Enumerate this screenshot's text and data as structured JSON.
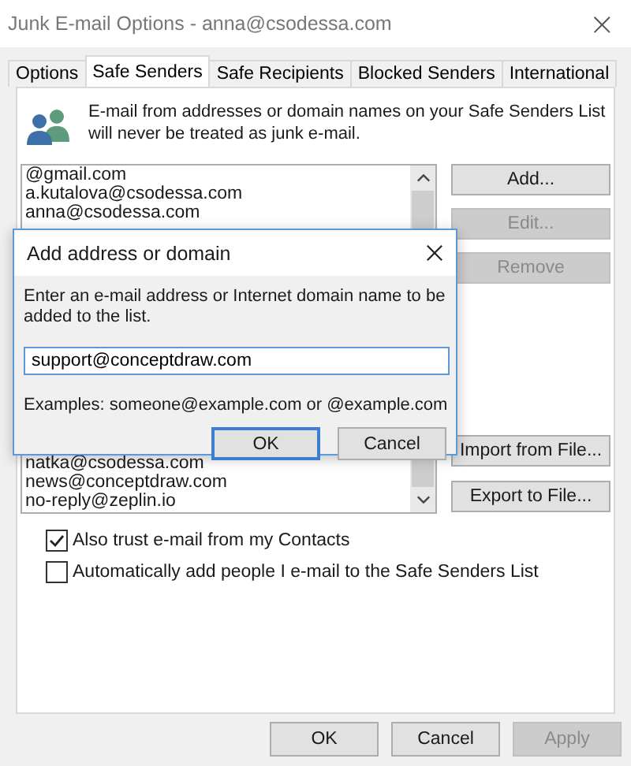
{
  "window": {
    "title": "Junk E-mail Options - anna@csodessa.com",
    "close": "×"
  },
  "tabs": [
    {
      "label": "Options",
      "selected": false
    },
    {
      "label": "Safe Senders",
      "selected": true
    },
    {
      "label": "Safe Recipients",
      "selected": false
    },
    {
      "label": "Blocked Senders",
      "selected": false
    },
    {
      "label": "International",
      "selected": false
    }
  ],
  "description": "E-mail from addresses or domain names on your Safe Senders List will never be treated as junk e-mail.",
  "senders_top": [
    "@gmail.com",
    "a.kutalova@csodessa.com",
    "anna@csodessa.com"
  ],
  "senders_bottom": [
    "natka@csodessa.com",
    "news@conceptdraw.com",
    "no-reply@zeplin.io"
  ],
  "side_buttons": [
    {
      "label": "Add...",
      "disabled": false
    },
    {
      "label": "Edit...",
      "disabled": true
    },
    {
      "label": "Remove",
      "disabled": true
    },
    {
      "label": "Import from File...",
      "disabled": false
    },
    {
      "label": "Export to File...",
      "disabled": false
    }
  ],
  "options": [
    {
      "label": "Also trust e-mail from my Contacts",
      "checked": true
    },
    {
      "label": "Automatically add people I e-mail to the Safe Senders List",
      "checked": false
    }
  ],
  "footer_buttons": [
    {
      "label": "OK",
      "disabled": false
    },
    {
      "label": "Cancel",
      "disabled": false
    },
    {
      "label": "Apply",
      "disabled": true
    }
  ],
  "dialog": {
    "title": "Add address or domain",
    "prompt": "Enter an e-mail address or Internet domain name to be added to the list.",
    "value": "support@conceptdraw.com",
    "examples": "Examples: someone@example.com or @example.com",
    "buttons": [
      {
        "label": "OK",
        "default": true
      },
      {
        "label": "Cancel",
        "default": false
      }
    ]
  }
}
